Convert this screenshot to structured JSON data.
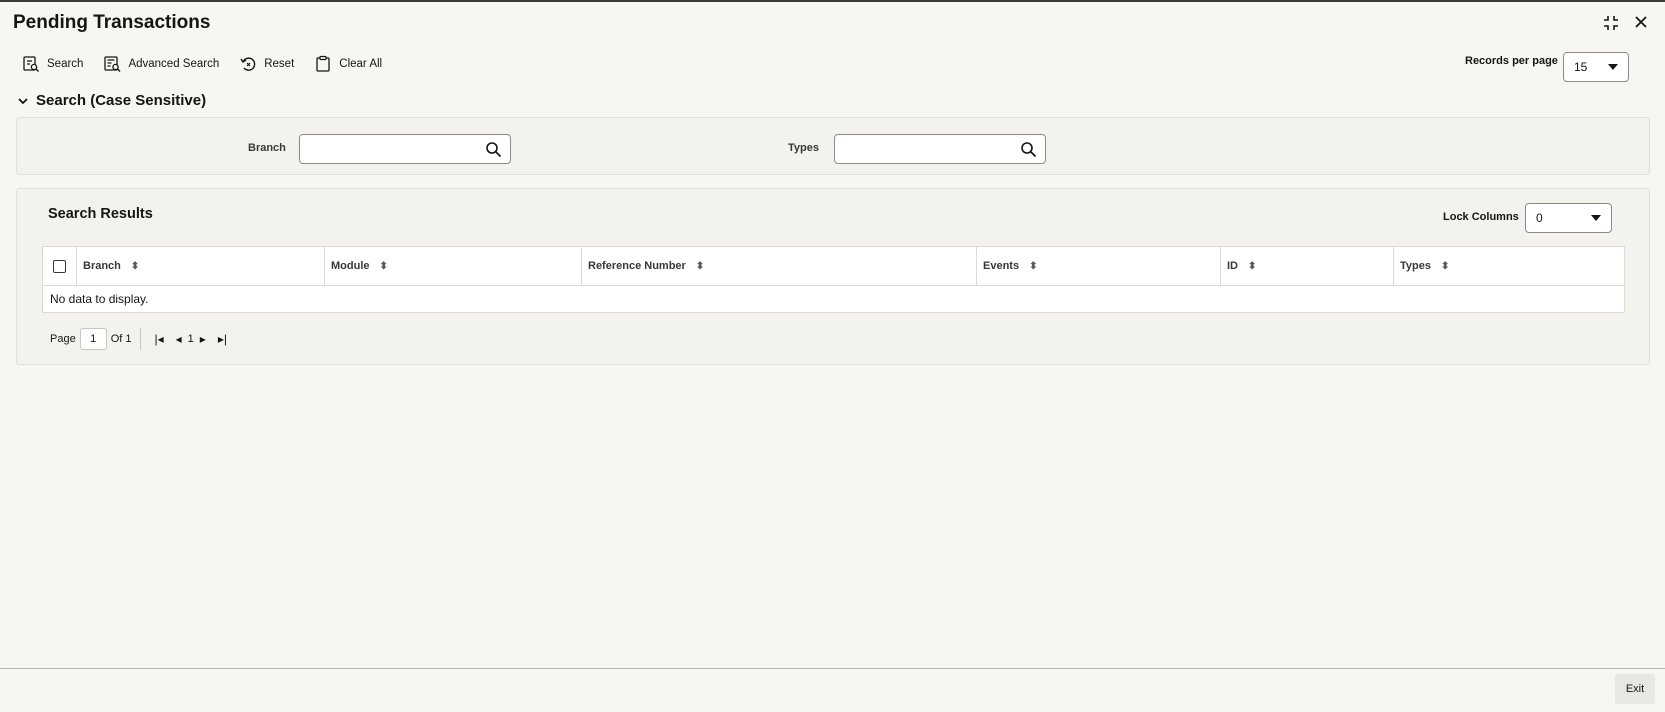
{
  "window": {
    "title": "Pending Transactions"
  },
  "toolbar": {
    "search_label": "Search",
    "advanced_search_label": "Advanced Search",
    "reset_label": "Reset",
    "clear_all_label": "Clear All"
  },
  "records_per_page": {
    "label": "Records per page",
    "value": "15"
  },
  "search_section": {
    "title": "Search (Case Sensitive)",
    "fields": {
      "branch": {
        "label": "Branch",
        "value": ""
      },
      "types": {
        "label": "Types",
        "value": ""
      }
    }
  },
  "results": {
    "title": "Search Results",
    "lock_columns": {
      "label": "Lock Columns",
      "value": "0"
    },
    "columns": [
      "Branch",
      "Module",
      "Reference Number",
      "Events",
      "ID",
      "Types"
    ],
    "empty_message": "No data to display.",
    "pagination": {
      "page_label": "Page",
      "page_value": "1",
      "of_label": "Of 1",
      "current": "1"
    }
  },
  "footer": {
    "exit_label": "Exit"
  }
}
